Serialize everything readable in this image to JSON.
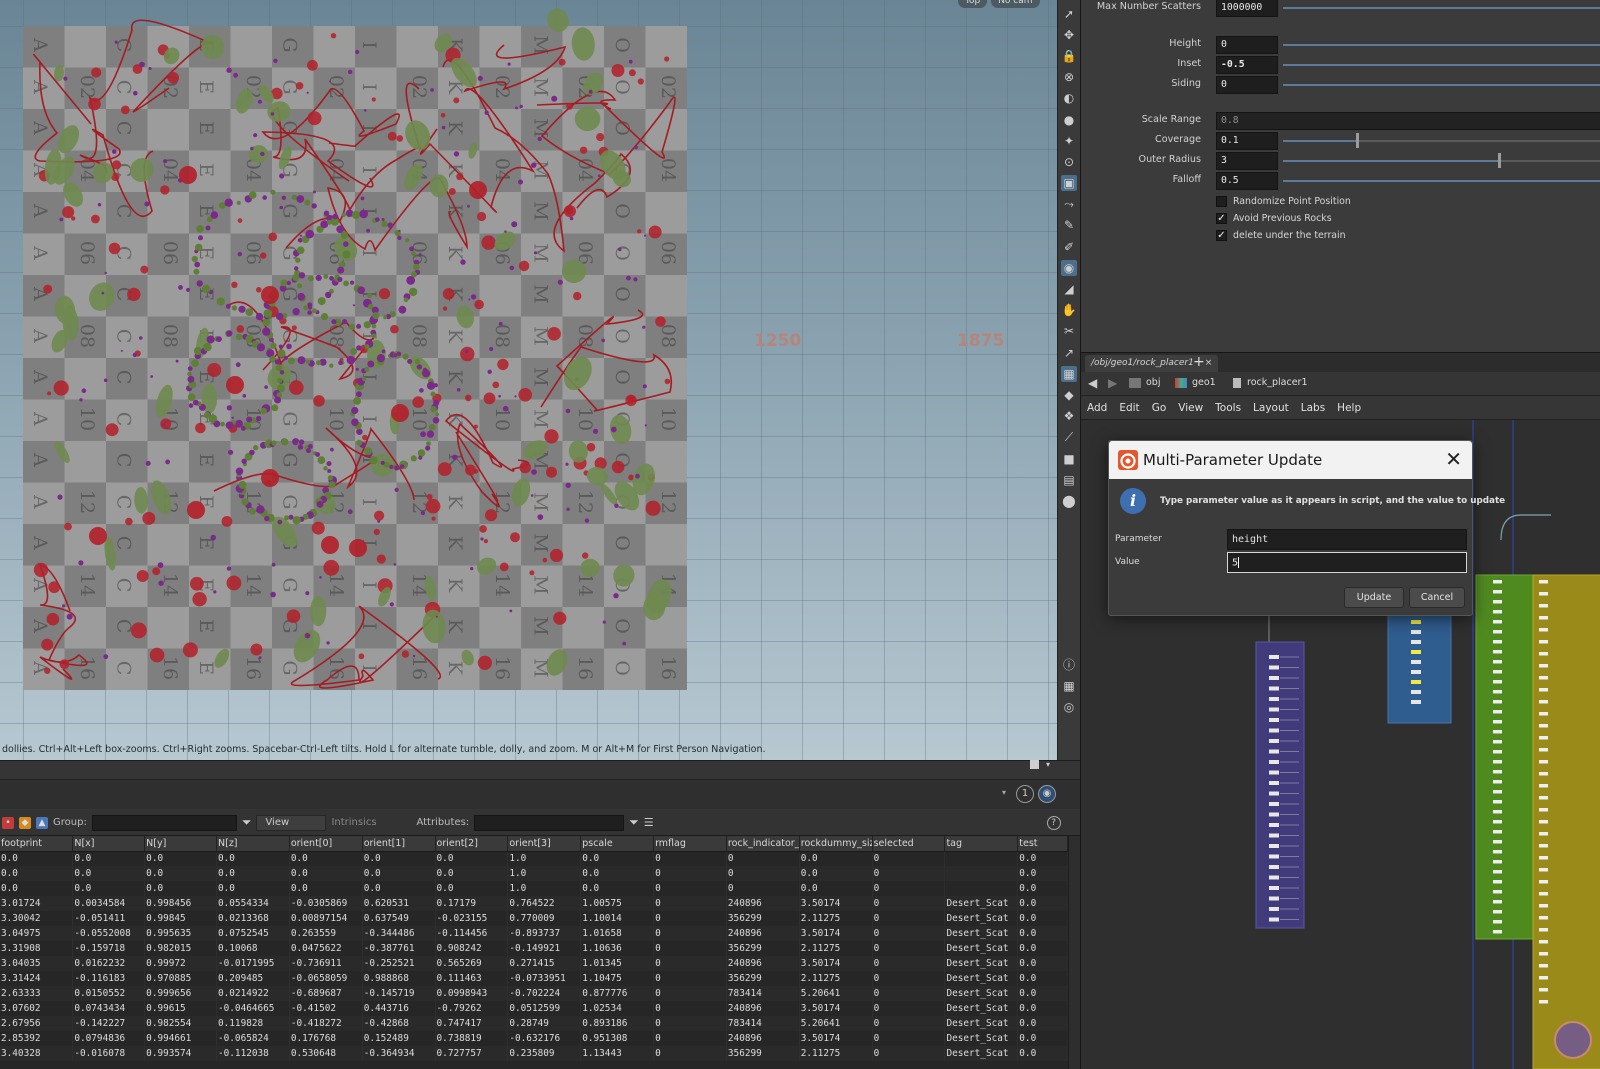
{
  "viewport": {
    "camera_buttons": [
      "Top",
      "No cam"
    ],
    "axis_numbers": [
      "1250",
      "1875"
    ],
    "status_text": "dollies. Ctrl+Alt+Left box-zooms. Ctrl+Right zooms. Spacebar-Ctrl-Left tilts. Hold L for alternate tumble, dolly, and zoom. M or Alt+M for First Person Navigation."
  },
  "parameters": {
    "max_scatters": {
      "label": "Max Number Scatters",
      "value": "1000000"
    },
    "height": {
      "label": "Height",
      "value": "0"
    },
    "inset": {
      "label": "Inset",
      "value": "-0.5"
    },
    "siding": {
      "label": "Siding",
      "value": "0"
    },
    "scale_range": {
      "label": "Scale Range",
      "value": "0.8"
    },
    "coverage": {
      "label": "Coverage",
      "value": "0.1",
      "slider_fraction": 0.22
    },
    "outer_radius": {
      "label": "Outer Radius",
      "value": "3",
      "slider_fraction": 0.65
    },
    "falloff": {
      "label": "Falloff",
      "value": "0.5"
    },
    "checkboxes": [
      {
        "label": "Randomize Point Position",
        "checked": false
      },
      {
        "label": "Avoid Previous Rocks",
        "checked": true
      },
      {
        "label": "delete under the terrain",
        "checked": true
      }
    ]
  },
  "network": {
    "tab_label": "/obj/geo1/rock_placer1",
    "path": [
      "obj",
      "geo1",
      "rock_placer1"
    ],
    "menu": [
      "Add",
      "Edit",
      "Go",
      "View",
      "Tools",
      "Layout",
      "Labs",
      "Help"
    ]
  },
  "dialog": {
    "title": "Multi-Parameter Update",
    "message": "Type parameter value as it appears in script, and the value to update",
    "parameter_label": "Parameter",
    "parameter_value": "height",
    "value_label": "Value",
    "value_value": "5",
    "update_label": "Update",
    "cancel_label": "Cancel"
  },
  "spreadsheet": {
    "group_label": "Group:",
    "view_label": "View",
    "intrinsics_label": "Intrinsics",
    "attributes_label": "Attributes:",
    "columns": [
      "footprint",
      "N[x]",
      "N[y]",
      "N[z]",
      "orient[0]",
      "orient[1]",
      "orient[2]",
      "orient[3]",
      "pscale",
      "rmflag",
      "rock_indicator_",
      "rockdummy_siz",
      "selected",
      "tag",
      "test"
    ],
    "rows": [
      [
        "0.0",
        "0.0",
        "0.0",
        "0.0",
        "0.0",
        "0.0",
        "0.0",
        "1.0",
        "0.0",
        "0",
        "0",
        "0.0",
        "0",
        "",
        "0.0"
      ],
      [
        "0.0",
        "0.0",
        "0.0",
        "0.0",
        "0.0",
        "0.0",
        "0.0",
        "1.0",
        "0.0",
        "0",
        "0",
        "0.0",
        "0",
        "",
        "0.0"
      ],
      [
        "0.0",
        "0.0",
        "0.0",
        "0.0",
        "0.0",
        "0.0",
        "0.0",
        "1.0",
        "0.0",
        "0",
        "0",
        "0.0",
        "0",
        "",
        "0.0"
      ],
      [
        "3.01724",
        "0.0034584",
        "0.998456",
        "0.0554334",
        "-0.0305869",
        "0.620531",
        "0.17179",
        "0.764522",
        "1.00575",
        "0",
        "240896",
        "3.50174",
        "0",
        "Desert_Scat",
        "0.0"
      ],
      [
        "3.30042",
        "-0.051411",
        "0.99845",
        "0.0213368",
        "0.00897154",
        "0.637549",
        "-0.023155",
        "0.770009",
        "1.10014",
        "0",
        "356299",
        "2.11275",
        "0",
        "Desert_Scat",
        "0.0"
      ],
      [
        "3.04975",
        "-0.0552008",
        "0.995635",
        "0.0752545",
        "0.263559",
        "-0.344486",
        "-0.114456",
        "-0.893737",
        "1.01658",
        "0",
        "240896",
        "3.50174",
        "0",
        "Desert_Scat",
        "0.0"
      ],
      [
        "3.31908",
        "-0.159718",
        "0.982015",
        "0.10068",
        "0.0475622",
        "-0.387761",
        "0.908242",
        "-0.149921",
        "1.10636",
        "0",
        "356299",
        "2.11275",
        "0",
        "Desert_Scat",
        "0.0"
      ],
      [
        "3.04035",
        "0.0162232",
        "0.99972",
        "-0.0171995",
        "-0.736911",
        "-0.252521",
        "0.565269",
        "0.271415",
        "1.01345",
        "0",
        "240896",
        "3.50174",
        "0",
        "Desert_Scat",
        "0.0"
      ],
      [
        "3.31424",
        "-0.116183",
        "0.970885",
        "0.209485",
        "-0.0658059",
        "0.988868",
        "0.111463",
        "-0.0733951",
        "1.10475",
        "0",
        "356299",
        "2.11275",
        "0",
        "Desert_Scat",
        "0.0"
      ],
      [
        "2.63333",
        "0.0150552",
        "0.999656",
        "0.0214922",
        "-0.689687",
        "-0.145719",
        "0.0998943",
        "-0.702224",
        "0.877776",
        "0",
        "783414",
        "5.20641",
        "0",
        "Desert_Scat",
        "0.0"
      ],
      [
        "3.07602",
        "0.0743434",
        "0.99615",
        "-0.0464665",
        "-0.41502",
        "0.443716",
        "-0.79262",
        "0.0512599",
        "1.02534",
        "0",
        "240896",
        "3.50174",
        "0",
        "Desert_Scat",
        "0.0"
      ],
      [
        "2.67956",
        "-0.142227",
        "0.982554",
        "0.119828",
        "-0.418272",
        "-0.42868",
        "0.747417",
        "0.28749",
        "0.893186",
        "0",
        "783414",
        "5.20641",
        "0",
        "Desert_Scat",
        "0.0"
      ],
      [
        "2.85392",
        "0.0794836",
        "0.994661",
        "-0.065824",
        "0.176768",
        "0.152489",
        "0.738819",
        "-0.632176",
        "0.951308",
        "0",
        "240896",
        "3.50174",
        "0",
        "Desert_Scat",
        "0.0"
      ],
      [
        "3.40328",
        "-0.016078",
        "0.993574",
        "-0.112038",
        "0.530648",
        "-0.364934",
        "0.727757",
        "0.235809",
        "1.13443",
        "0",
        "356299",
        "2.11275",
        "0",
        "Desert_Scat",
        "0.0"
      ]
    ]
  },
  "colors": {
    "accent_blue": "#5d7a9a",
    "brand_orange": "#e4572e",
    "scatter_red": "#b3202a",
    "scatter_green": "#6f8a4f",
    "scatter_purple": "#7b2a8a"
  },
  "icons": {
    "toolbar": [
      "select-icon",
      "transform-icon",
      "lock-icon",
      "snap-icon",
      "sphere-icon",
      "light-icon",
      "bulb-icon",
      "camera-icon",
      "view-icon",
      "handle-icon",
      "brush-icon",
      "pen-icon",
      "points-icon",
      "paint-icon",
      "sculpt-icon",
      "edit-icon",
      "measure-icon",
      "grid-icon",
      "shape-icon",
      "sprite-icon",
      "knife-icon",
      "box-icon",
      "image-icon",
      "pin-icon",
      "info-icon",
      "layout-icon",
      "eye-icon"
    ]
  }
}
